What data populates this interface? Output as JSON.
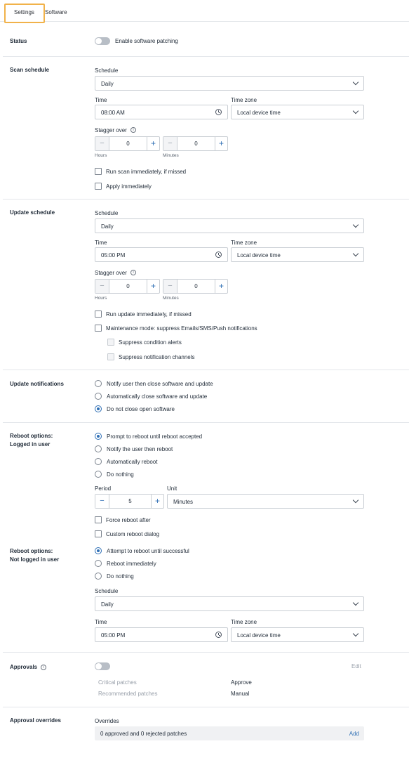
{
  "tabs": {
    "settings": "Settings",
    "software": "Software"
  },
  "status": {
    "label": "Status",
    "toggle_label": "Enable software patching"
  },
  "scan": {
    "label": "Scan schedule",
    "schedule_label": "Schedule",
    "schedule_value": "Daily",
    "time_label": "Time",
    "time_value": "08:00 AM",
    "tz_label": "Time zone",
    "tz_value": "Local device time",
    "stagger_label": "Stagger over",
    "hours_value": "0",
    "hours_label": "Hours",
    "minutes_value": "0",
    "minutes_label": "Minutes",
    "run_missed": "Run scan immediately, if missed",
    "apply_immediately": "Apply immediately"
  },
  "update": {
    "label": "Update schedule",
    "schedule_label": "Schedule",
    "schedule_value": "Daily",
    "time_label": "Time",
    "time_value": "05:00 PM",
    "tz_label": "Time zone",
    "tz_value": "Local device time",
    "stagger_label": "Stagger over",
    "hours_value": "0",
    "hours_label": "Hours",
    "minutes_value": "0",
    "minutes_label": "Minutes",
    "run_missed": "Run update immediately, if missed",
    "maintenance": "Maintenance mode: suppress Emails/SMS/Push notifications",
    "suppress_condition": "Suppress condition alerts",
    "suppress_channels": "Suppress notification channels"
  },
  "notifications": {
    "label": "Update notifications",
    "options": [
      "Notify user then close software and update",
      "Automatically close software and update",
      "Do not close open software"
    ],
    "selected": 2
  },
  "reboot_logged": {
    "label_line1": "Reboot options:",
    "label_line2": "Logged in user",
    "options": [
      "Prompt to reboot until reboot accepted",
      "Notify the user then reboot",
      "Automatically reboot",
      "Do nothing"
    ],
    "selected": 0,
    "period_label": "Period",
    "period_value": "5",
    "unit_label": "Unit",
    "unit_value": "Minutes",
    "force_reboot": "Force reboot after",
    "custom_dialog": "Custom reboot dialog"
  },
  "reboot_not_logged": {
    "label_line1": "Reboot options:",
    "label_line2": "Not logged in user",
    "options": [
      "Attempt to reboot until successful",
      "Reboot immediately",
      "Do nothing"
    ],
    "selected": 0,
    "schedule_label": "Schedule",
    "schedule_value": "Daily",
    "time_label": "Time",
    "time_value": "05:00 PM",
    "tz_label": "Time zone",
    "tz_value": "Local device time"
  },
  "approvals": {
    "label": "Approvals",
    "edit": "Edit",
    "rows": [
      {
        "name": "Critical patches",
        "value": "Approve"
      },
      {
        "name": "Recommended patches",
        "value": "Manual"
      }
    ]
  },
  "overrides": {
    "label": "Approval overrides",
    "overrides_label": "Overrides",
    "summary": "0 approved and 0 rejected patches",
    "add": "Add"
  },
  "colors": {
    "accent": "#2f6fb5",
    "tab_highlight": "#f1b24a"
  }
}
